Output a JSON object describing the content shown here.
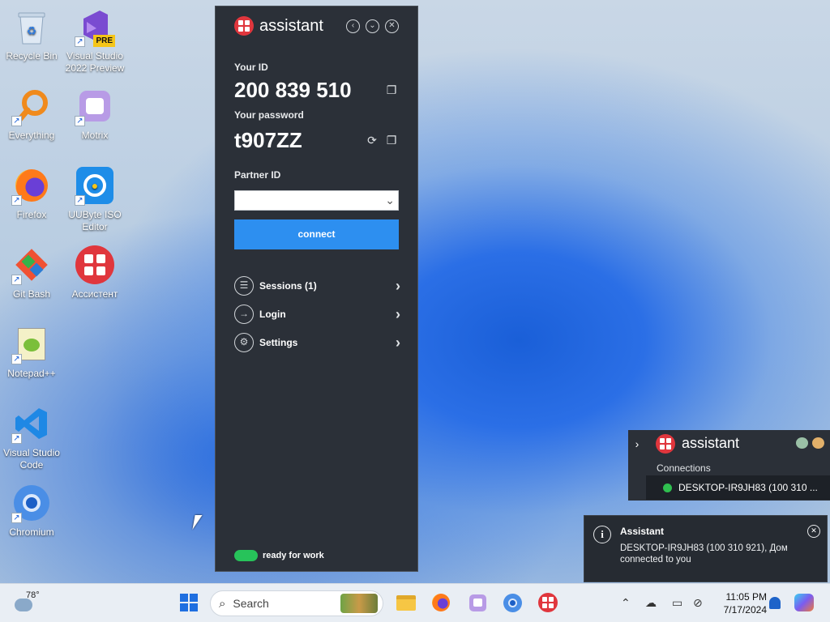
{
  "desktop": {
    "icons": [
      {
        "label": "Recycle Bin",
        "icon": "recycle-bin-icon"
      },
      {
        "label": "Visual Studio 2022 Preview",
        "icon": "visual-studio-icon",
        "badge": "PRE"
      },
      {
        "label": "Everything",
        "icon": "everything-search-icon"
      },
      {
        "label": "Motrix",
        "icon": "motrix-icon"
      },
      {
        "label": "Firefox",
        "icon": "firefox-icon"
      },
      {
        "label": "UUByte ISO Editor",
        "icon": "uubyte-iso-editor-icon"
      },
      {
        "label": "Git Bash",
        "icon": "git-bash-icon"
      },
      {
        "label": "Ассистент",
        "icon": "assistant-icon"
      },
      {
        "label": "Notepad++",
        "icon": "notepad-plus-plus-icon"
      },
      {
        "label": "Visual Studio Code",
        "icon": "vscode-icon"
      },
      {
        "label": "Chromium",
        "icon": "chromium-icon"
      }
    ]
  },
  "assistant_panel": {
    "brand": "assistant",
    "your_id_label": "Your ID",
    "your_id": "200 839 510",
    "password_label": "Your password",
    "password": "t907ZZ",
    "partner_id_label": "Partner ID",
    "partner_id_value": "",
    "connect_label": "connect",
    "menu": [
      {
        "label": "Sessions (1)",
        "icon": "list-icon"
      },
      {
        "label": "Login",
        "icon": "login-icon"
      },
      {
        "label": "Settings",
        "icon": "gears-icon"
      }
    ],
    "status_text": "ready for work",
    "status_color": "#27c35a",
    "accent_color": "#2d8ff0",
    "brand_color": "#e0363d"
  },
  "connections_flyout": {
    "brand": "assistant",
    "section_title": "Connections",
    "connection": "DESKTOP-IR9JH83 (100 310 ..."
  },
  "toast": {
    "title": "Assistant",
    "body": "DESKTOP-IR9JH83 (100 310 921), Дом connected to you"
  },
  "taskbar": {
    "weather_temp": "78°",
    "search_placeholder": "Search",
    "time": "11:05 PM",
    "date": "7/17/2024",
    "pinned": [
      "windows-start-icon",
      "file-explorer-icon",
      "firefox-icon",
      "motrix-icon",
      "chromium-icon",
      "assistant-icon"
    ],
    "tray": [
      "chevron-up-icon",
      "onedrive-offline-icon",
      "display-icon",
      "network-icon",
      "notification-bell-icon",
      "copilot-icon"
    ]
  }
}
